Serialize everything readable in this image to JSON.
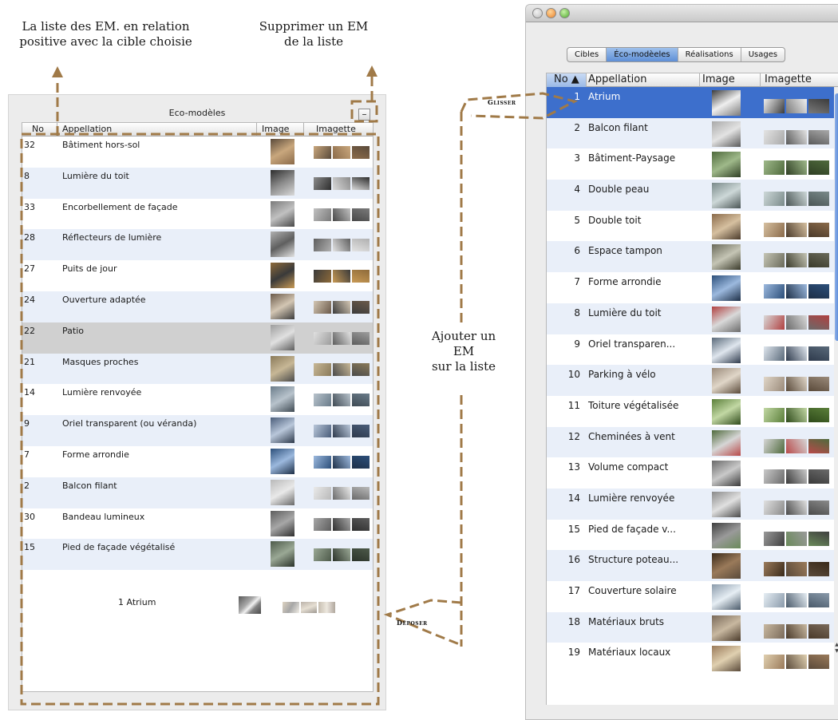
{
  "annotations": {
    "related_list": [
      "La liste des EM. en relation",
      "positive avec la cible choisie"
    ],
    "remove": [
      "Supprimer un EM",
      "de la liste"
    ],
    "add": [
      "Ajouter un",
      "EM",
      "sur la  liste"
    ],
    "drag_label": "Glisser",
    "drop_label": "Déposer"
  },
  "left_panel": {
    "title": "Eco-modèles",
    "remove_button": "–",
    "columns": [
      "No",
      "Appellation",
      "Image",
      "Imagette"
    ],
    "rows": [
      {
        "no": "32",
        "name": "Bâtiment hors-sol"
      },
      {
        "no": "8",
        "name": "Lumière du toit"
      },
      {
        "no": "33",
        "name": "Encorbellement de façade"
      },
      {
        "no": "28",
        "name": "Réflecteurs de lumière"
      },
      {
        "no": "27",
        "name": "Puits de jour"
      },
      {
        "no": "24",
        "name": "Ouverture adaptée"
      },
      {
        "no": "22",
        "name": "Patio"
      },
      {
        "no": "21",
        "name": "Masques proches"
      },
      {
        "no": "14",
        "name": "Lumière renvoyée"
      },
      {
        "no": "9",
        "name": "Oriel transparent (ou véranda)"
      },
      {
        "no": "7",
        "name": "Forme arrondie"
      },
      {
        "no": "2",
        "name": "Balcon filant"
      },
      {
        "no": "30",
        "name": "Bandeau lumineux"
      },
      {
        "no": "15",
        "name": "Pied de façade végétalisé"
      }
    ],
    "dragged_item": "1  Atrium"
  },
  "right_window": {
    "tabs": [
      "Cibles",
      "Éco-modèeles",
      "Réalisations",
      "Usages"
    ],
    "active_tab": 1,
    "columns": [
      "No ▲",
      "Appellation",
      "Image",
      "Imagette"
    ],
    "rows": [
      {
        "no": "1",
        "name": "Atrium"
      },
      {
        "no": "2",
        "name": "Balcon filant"
      },
      {
        "no": "3",
        "name": "Bâtiment-Paysage"
      },
      {
        "no": "4",
        "name": "Double peau"
      },
      {
        "no": "5",
        "name": "Double toit"
      },
      {
        "no": "6",
        "name": "Espace tampon"
      },
      {
        "no": "7",
        "name": "Forme arrondie"
      },
      {
        "no": "8",
        "name": "Lumière du toit"
      },
      {
        "no": "9",
        "name": "Oriel transparen..."
      },
      {
        "no": "10",
        "name": "Parking à vélo"
      },
      {
        "no": "11",
        "name": "Toiture végétalisée"
      },
      {
        "no": "12",
        "name": "Cheminées à vent"
      },
      {
        "no": "13",
        "name": "Volume compact"
      },
      {
        "no": "14",
        "name": "Lumière renvoyée"
      },
      {
        "no": "15",
        "name": "Pied de façade v..."
      },
      {
        "no": "16",
        "name": "Structure poteau..."
      },
      {
        "no": "17",
        "name": "Couverture solaire"
      },
      {
        "no": "18",
        "name": "Matériaux bruts"
      },
      {
        "no": "19",
        "name": "Matériaux locaux"
      }
    ]
  },
  "colors": {
    "annotation_dash": "#a07a48",
    "selection_blue": "#3d6fcc",
    "row_alt": "#e9eff9",
    "selected_grey": "#d0d0d0"
  },
  "icons": [
    "building-photo-thumbnail",
    "close-light-icon",
    "minimize-light-icon",
    "zoom-light-icon",
    "sort-ascending-icon"
  ]
}
